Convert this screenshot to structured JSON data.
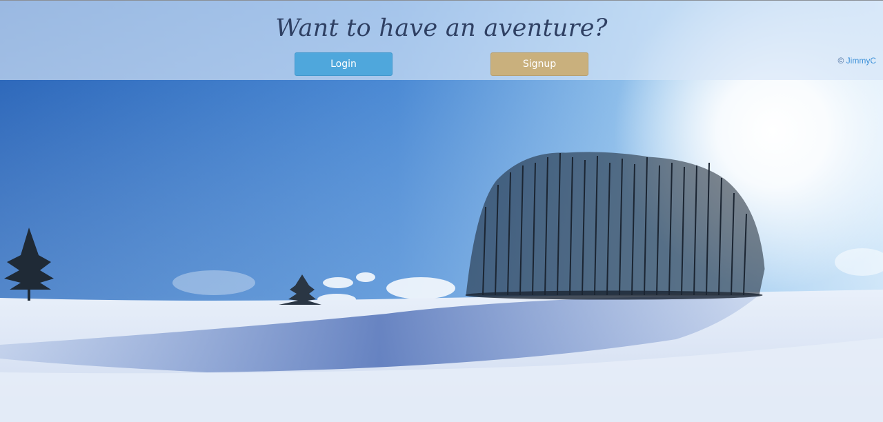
{
  "header": {
    "headline": "Want to have an aventure?",
    "login_label": "Login",
    "signup_label": "Signup",
    "copyright_symbol": "©",
    "copyright_name": "JimmyC"
  },
  "colors": {
    "login_button": "#4fa7dc",
    "signup_button": "#c9b07d",
    "headline": "#2f4063",
    "link": "#3a8fd8"
  },
  "background": {
    "icons": [
      "snow-landscape-image",
      "tree-cluster-icon",
      "lone-tree-icon",
      "small-tree-icon",
      "sun-glow-icon"
    ]
  }
}
